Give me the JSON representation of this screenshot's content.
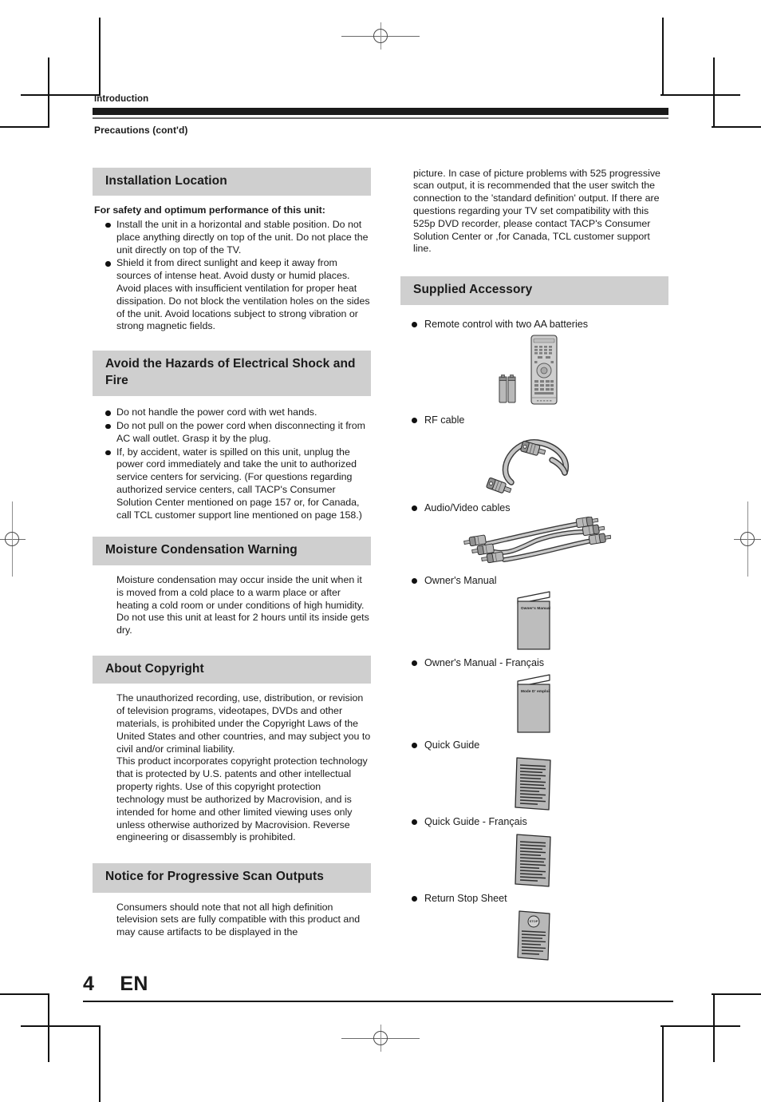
{
  "document": {
    "running_head": "Introduction",
    "page_subtitle": "Precautions (cont'd)",
    "page_number": "4",
    "language_code": "EN",
    "section_header_bg": "#cfcfcf",
    "rule_color": "#1a1a1a"
  },
  "left_column": {
    "installation": {
      "heading": "Installation Location",
      "lead": "For safety and optimum performance of this unit:",
      "bullets": [
        "Install the unit in a horizontal and stable position. Do not place anything directly on top of the unit. Do not place the unit directly on top of the TV.",
        "Shield it from direct sunlight and keep it away from sources of intense heat. Avoid dusty or humid places. Avoid places with insufficient ventilation for proper heat dissipation. Do not block the ventilation holes on the sides of the unit.  Avoid locations subject to strong vibration or strong magnetic fields."
      ]
    },
    "hazards": {
      "heading": "Avoid the Hazards of Electrical Shock and Fire",
      "bullets": [
        "Do not handle the power cord with wet hands.",
        "Do not pull on the power cord when disconnecting it from AC wall outlet. Grasp it by the plug.",
        "If, by accident, water is spilled on this unit, unplug the power cord immediately and take the unit to authorized service centers for servicing. (For questions regarding authorized service centers, call TACP's Consumer Solution Center mentioned on page 157 or, for Canada, call TCL customer support line mentioned on page 158.)"
      ]
    },
    "moisture": {
      "heading": "Moisture Condensation Warning",
      "paragraphs": [
        "Moisture condensation may occur inside the unit when it is moved from a cold place to a warm place or after heating a cold room or under conditions of high humidity. Do not use this unit at least for 2 hours until its inside gets dry."
      ]
    },
    "copyright": {
      "heading": "About Copyright",
      "paragraphs": [
        "The unauthorized recording, use, distribution, or revision of television programs, videotapes, DVDs and other materials, is prohibited under the Copyright Laws of the United States and other countries, and may subject you to civil and/or criminal liability.",
        "This product incorporates copyright protection technology that is protected by U.S. patents and other intellectual property rights. Use of this copyright protection technology must be authorized by Macrovision, and is intended for home and other limited viewing uses only unless otherwise authorized by Macrovision. Reverse engineering or disassembly is prohibited."
      ]
    },
    "progressive": {
      "heading": "Notice for Progressive Scan Outputs",
      "paragraphs": [
        "Consumers should note that not all high definition television sets are fully compatible with this product and may cause artifacts to be displayed in the"
      ]
    }
  },
  "right_column": {
    "continued_text": "picture.  In case of picture problems with 525 progressive scan output, it is recommended that the user switch the connection to the 'standard definition' output. If there are questions regarding your TV set compatibility with this 525p DVD recorder, please contact TACP's Consumer Solution Center or ,for Canada, TCL customer support line.",
    "accessory": {
      "heading": "Supplied Accessory",
      "items": [
        {
          "label": "Remote control with two AA batteries",
          "figure": "remote-control-and-batteries"
        },
        {
          "label": "RF cable",
          "figure": "rf-cable"
        },
        {
          "label": "Audio/Video cables",
          "figure": "av-cables"
        },
        {
          "label": "Owner's Manual",
          "figure": "booklet",
          "cover_title": "Owner's Manual"
        },
        {
          "label": "Owner's Manual - Français",
          "figure": "booklet",
          "cover_title": "Mode D' emploi"
        },
        {
          "label": "Quick Guide",
          "figure": "sheet"
        },
        {
          "label": "Quick Guide - Français",
          "figure": "sheet"
        },
        {
          "label": "Return Stop Sheet",
          "figure": "sheet-with-seal",
          "seal_title": "STOP"
        }
      ]
    }
  }
}
